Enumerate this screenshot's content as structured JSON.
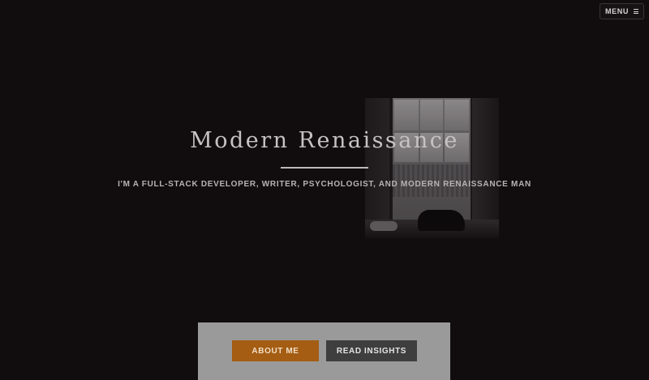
{
  "header": {
    "menu_label": "MENU",
    "menu_icon": "hamburger-icon"
  },
  "hero": {
    "title": "Modern Renaissance",
    "subtitle": "I'M A FULL-STACK DEVELOPER, WRITER, PSYCHOLOGIST, AND MODERN RENAISSANCE MAN",
    "image_subject": "window-photo"
  },
  "cta": {
    "about_label": "ABOUT ME",
    "insights_label": "READ INSIGHTS"
  },
  "colors": {
    "background": "#110d0f",
    "accent": "#a45d12",
    "secondary_button": "#3e3e3e",
    "panel": "#9a9a9a"
  }
}
